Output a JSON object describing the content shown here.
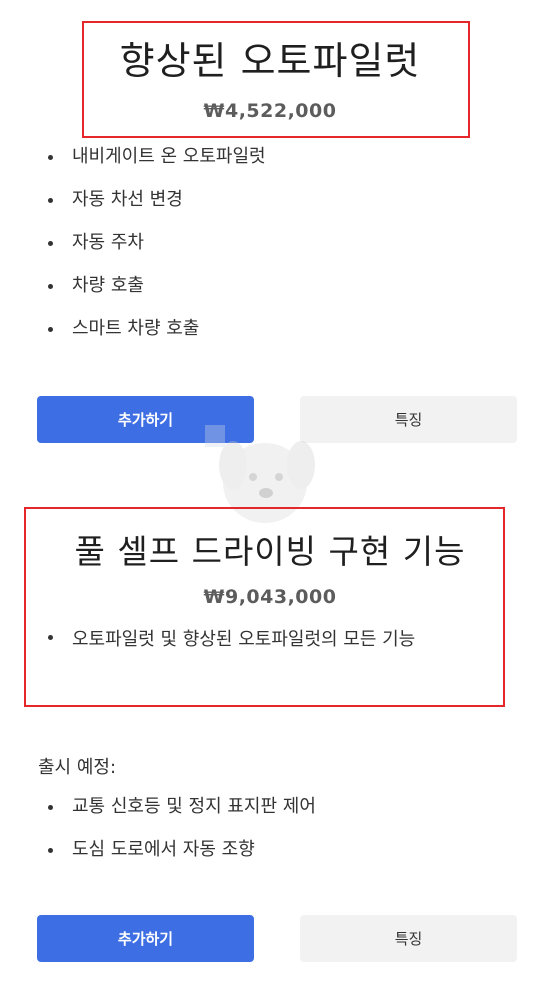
{
  "option1": {
    "title": "향상된 오토파일럿",
    "price": "₩4,522,000",
    "features": [
      "내비게이트 온 오토파일럿",
      "자동 차선 변경",
      "자동 주차",
      "차량 호출",
      "스마트 차량 호출"
    ],
    "add_label": "추가하기",
    "features_label": "특징"
  },
  "option2": {
    "title": "풀 셀프 드라이빙 구현 기능",
    "price": "₩9,043,000",
    "features": [
      "오토파일럿 및 향상된 오토파일럿의 모든 기능"
    ],
    "upcoming_label": "출시 예정:",
    "upcoming": [
      "교통 신호등 및 정지 표지판 제어",
      "도심 도로에서 자동 조향"
    ],
    "add_label": "추가하기",
    "features_label": "특징"
  },
  "colors": {
    "accent": "#3d6ee3",
    "highlight": "#e5262b",
    "secondary_button": "#f2f2f2"
  }
}
